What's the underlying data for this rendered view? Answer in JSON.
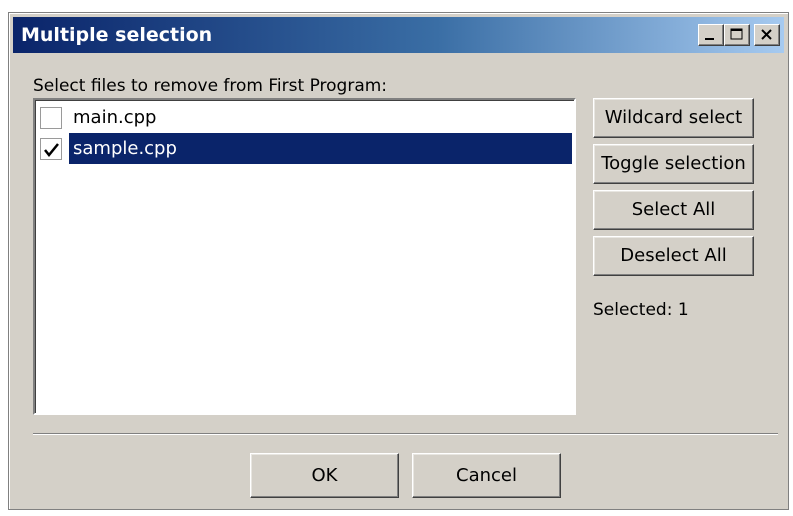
{
  "window": {
    "title": "Multiple selection",
    "controls": {
      "minimize_icon": "minimize-icon",
      "maximize_icon": "maximize-icon",
      "close_icon": "close-icon"
    }
  },
  "prompt": "Select files to remove from First Program:",
  "files": [
    {
      "name": "main.cpp",
      "checked": false,
      "selected": false
    },
    {
      "name": "sample.cpp",
      "checked": true,
      "selected": true
    }
  ],
  "side_buttons": {
    "wildcard": "Wildcard select",
    "toggle": "Toggle selection",
    "select_all": "Select All",
    "deselect_all": "Deselect All"
  },
  "status": "Selected: 1",
  "dialog_buttons": {
    "ok": "OK",
    "cancel": "Cancel"
  },
  "colors": {
    "title_gradient_start": "#0a246a",
    "title_gradient_end": "#a6caf0",
    "selection_highlight": "#0a246a",
    "window_face": "#d4d0c8"
  }
}
